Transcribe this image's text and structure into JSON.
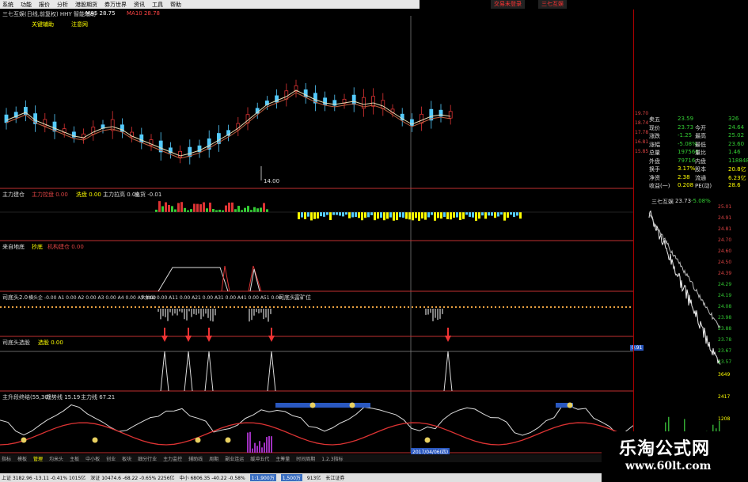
{
  "menu": [
    "系统",
    "功能",
    "报价",
    "分析",
    "港股期货",
    "券万世界",
    "资讯",
    "工具",
    "帮助"
  ],
  "topright": {
    "btn1": "交易未登录",
    "btn2": "三七互娱"
  },
  "header": {
    "title_line": "三七互娱(日线,前复权) HHY 智能辅助",
    "ma_text": "MA5 28.75",
    "ma2_text": "MA10 28.78",
    "sub1": "关键辅助",
    "sub2": "注意网"
  },
  "kline": {
    "low_label": "14.00"
  },
  "panels": {
    "p2": {
      "a": "主力建仓",
      "b": "主力控盘 0.00",
      "c": "洗盘 0.00",
      "d": "主力拉高 0.00",
      "e": "出货 -0.01"
    },
    "p3": {
      "a": "来自地底",
      "b": "抄底",
      "c": "机构建仓 0.00"
    },
    "p4": {
      "a": "司底头2.0",
      "b": "横头企 -0.00 A1 0.00 A2 0.00 A3 0.00 A4 0.00 A5 0.00",
      "c": "大抽山 0.00 A11 0.00 A21 0.00 A31 0.00 A41 0.00 A51 0.00",
      "d": "司底头",
      "e": "富矿位"
    },
    "p5": {
      "a": "司底头选股",
      "b": "选股 0.00"
    },
    "p6": {
      "a": "主升段终结(55,30)",
      "b": "趋势线 15.19",
      "c": "主力线 67.21"
    }
  },
  "date_box": "2017/04/06(四)",
  "right": {
    "rows": [
      {
        "k": "卖五",
        "v": "23.59",
        "v2": "",
        "n": "326"
      },
      {
        "k": "现价",
        "v": "23.73",
        "v2": "今开",
        "n": "24.64"
      },
      {
        "k": "涨跌",
        "v": "-1.25",
        "v2": "最高",
        "n": "25.02"
      },
      {
        "k": "涨幅",
        "v": "-5.08%",
        "v2": "最低",
        "n": "23.60"
      },
      {
        "k": "总量",
        "v": "197568",
        "v2": "量比",
        "n": "1.46"
      },
      {
        "k": "外盘",
        "v": "79716",
        "v2": "内盘",
        "n": "118848"
      },
      {
        "k": "换手",
        "v": "3.17%",
        "v2": "股本",
        "n": "20.8亿"
      },
      {
        "k": "净资",
        "v": "2.38",
        "v2": "流通",
        "n": "6.23亿"
      },
      {
        "k": "收益(一)",
        "v": "0.208",
        "v2": "PE(动)",
        "n": "28.6"
      }
    ],
    "mini_title": "三七互娱",
    "mini_val": "23.73",
    "mini_chg": "-5.08%",
    "price_ticks": [
      "25.01",
      "24.91",
      "24.81",
      "24.70",
      "24.60",
      "24.50",
      "24.39",
      "24.29",
      "24.19",
      "24.08",
      "23.98",
      "23.88",
      "23.78",
      "23.67",
      "23.57"
    ],
    "vol_ticks": [
      "3649",
      "2417",
      "1208"
    ]
  },
  "left_scale": [
    "19.70",
    "18.74",
    "17.78",
    "16.81",
    "15.85"
  ],
  "mid_val": "0.91",
  "bottom_tabs": [
    "指标",
    "模板",
    "管理",
    "均米头",
    "主板",
    "中小板",
    "创业",
    "板块",
    "细分行业",
    "主力监控",
    "辅助线",
    "周期",
    "副业连运",
    "缓冲五代",
    "主筹量",
    "时间周期",
    "1.2.3指标"
  ],
  "status": {
    "a": "上证 3182.96 -13.11 -0.41% 1015亿",
    "b": "深证 10474.6 -68.22 -0.65% 2256亿",
    "c": "中小 6806.35 -40.22 -0.58%",
    "d": "1:1,900万",
    "e": "1,500万",
    "f": "913亿",
    "g": "长江证券"
  },
  "watermark": {
    "cn": "乐淘公式网",
    "url": "www.60lt.com"
  }
}
